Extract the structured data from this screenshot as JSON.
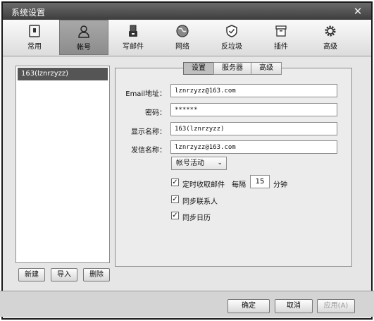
{
  "window": {
    "title": "系统设置",
    "close_icon": "close-icon"
  },
  "toolbar": {
    "items": [
      {
        "label": "常用",
        "icon": "general-icon"
      },
      {
        "label": "帐号",
        "icon": "account-icon"
      },
      {
        "label": "写邮件",
        "icon": "compose-icon"
      },
      {
        "label": "网络",
        "icon": "network-icon"
      },
      {
        "label": "反垃圾",
        "icon": "antispam-icon"
      },
      {
        "label": "插件",
        "icon": "plugin-icon"
      },
      {
        "label": "高级",
        "icon": "advanced-icon"
      }
    ],
    "active": "帐号"
  },
  "accounts": {
    "items": [
      "163(lznrzyzz)"
    ],
    "selected": "163(lznrzyzz)"
  },
  "left_buttons": {
    "new": "新建",
    "import": "导入",
    "delete": "删除"
  },
  "tabs": {
    "items": [
      "设置",
      "服务器",
      "高级"
    ],
    "active": "设置"
  },
  "form": {
    "email_label": "Email地址：",
    "email_value": "lznrzyzz@163.com",
    "password_label": "密码：",
    "password_value": "******",
    "display_name_label": "显示名称：",
    "display_name_value": "163(lznrzyzz)",
    "sender_name_label": "发信名称：",
    "sender_name_value": "lznrzyzz@163.com",
    "account_status": "帐号活动",
    "auto_fetch_label": "定时收取邮件",
    "auto_fetch_checked": true,
    "interval_label": "每隔",
    "interval_value": "15",
    "interval_unit": "分钟",
    "sync_contacts_label": "同步联系人",
    "sync_contacts_checked": true,
    "sync_calendar_label": "同步日历",
    "sync_calendar_checked": true
  },
  "footer": {
    "ok": "确定",
    "cancel": "取消",
    "apply": "应用(A)"
  },
  "colors": {
    "titlebar": "#4a4a4a",
    "selected_account": "#555555",
    "active_tab": "#bfbfbf"
  }
}
